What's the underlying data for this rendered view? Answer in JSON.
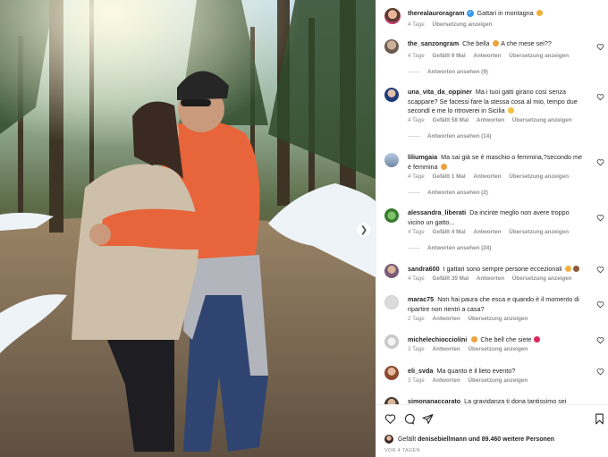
{
  "post": {
    "author": "therealauroragram",
    "caption": "Gattari in montagna",
    "time": "4 Tage",
    "translate": "Übersetzung anzeigen"
  },
  "comments": [
    {
      "user": "the_sanzongram",
      "text": "Che bella",
      "text_after": "A che mese sei??",
      "time": "4 Tage",
      "likes": "Gefällt 9 Mal",
      "reply": "Antworten",
      "translate": "Übersetzung anzeigen",
      "replies": "Antworten ansehen (9)"
    },
    {
      "user": "una_vita_da_oppiner",
      "text": "Ma i tuoi gatti girano così senza scappare? Se facessi fare la stessa cosa al mio, tempo due secondi e me lo ritroverei in Sicilia",
      "time": "4 Tage",
      "likes": "Gefällt 58 Mal",
      "reply": "Antworten",
      "translate": "Übersetzung anzeigen",
      "replies": "Antworten ansehen (14)"
    },
    {
      "user": "liliumgaia",
      "text": "Ma sai già se è maschio o femmina,?secondo me è femmina",
      "time": "4 Tage",
      "likes": "Gefällt 1 Mal",
      "reply": "Antworten",
      "translate": "Übersetzung anzeigen",
      "replies": "Antworten ansehen (2)"
    },
    {
      "user": "alessandra_liberati",
      "text": "Da incinte meglio non avere troppo vicino un gatto...",
      "time": "4 Tage",
      "likes": "Gefällt 4 Mal",
      "reply": "Antworten",
      "translate": "Übersetzung anzeigen",
      "replies": "Antworten ansehen (24)"
    },
    {
      "user": "sandra600",
      "text": "I gattari sono sempre persone eccezionali",
      "time": "4 Tage",
      "likes": "Gefällt 35 Mal",
      "reply": "Antworten",
      "translate": "Übersetzung anzeigen"
    },
    {
      "user": "marac75",
      "text": "Non hai paura che esca e quando è il momento di ripartire non rientri a casa?",
      "time": "2 Tage",
      "reply": "Antworten",
      "translate": "Übersetzung anzeigen"
    },
    {
      "user": "michelechiocciolini",
      "text": "Che bell che siete",
      "time": "3 Tage",
      "reply": "Antworten",
      "translate": "Übersetzung anzeigen"
    },
    {
      "user": "eli_svda",
      "text": "Ma quanto è il lieto evento?",
      "time": "3 Tage",
      "reply": "Antworten",
      "translate": "Übersetzung anzeigen"
    },
    {
      "user": "simonanaccarato",
      "text": "La gravidanza ti dona tantissimo sei"
    }
  ],
  "footer": {
    "liked_prefix": "Gefällt",
    "liked_user": "denisebiellmann",
    "liked_suffix": "und 89.460 weitere Personen",
    "date": "VOR 4 TAGEN"
  },
  "icons": {
    "heart": "heart-icon",
    "comment": "comment-icon",
    "share": "share-icon",
    "save": "bookmark-icon",
    "next": "chevron-right-icon"
  },
  "colors": {
    "verified": "#3897f0",
    "secondary_text": "#8e8e8e",
    "heart_red": "#ed4956"
  }
}
